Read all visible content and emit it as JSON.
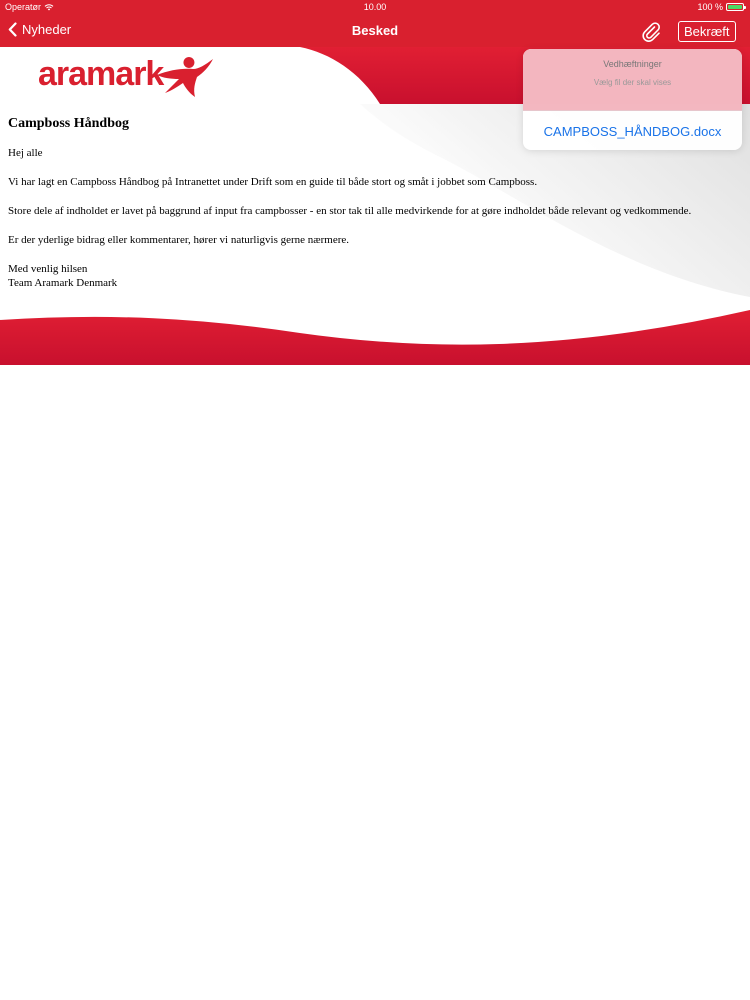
{
  "status_bar": {
    "carrier": "Operatør",
    "time": "10.00",
    "battery": "100 %",
    "battery_level": 1.0
  },
  "nav": {
    "back_label": "Nyheder",
    "title": "Besked",
    "confirm_label": "Bekræft"
  },
  "logo": {
    "text": "aramark"
  },
  "message": {
    "heading": "Campboss Håndbog",
    "greeting": "Hej alle",
    "paragraph_1": "Vi har lagt en Campboss Håndbog på Intranettet under Drift som en guide til både stort og småt i jobbet som Campboss.",
    "paragraph_2": "Store dele af indholdet er lavet på baggrund af input fra campbosser - en stor tak til alle medvirkende for at gøre indholdet både relevant og vedkommende.",
    "paragraph_3": "Er der yderlige bidrag eller kommentarer, hører vi naturligvis gerne nærmere.",
    "closing": "Med venlig hilsen",
    "signature": "Team Aramark Denmark"
  },
  "attachments_popover": {
    "title": "Vedhæftninger",
    "subtitle": "Vælg fil der skal vises",
    "files": [
      "CAMPBOSS_HÅNDBOG.docx"
    ]
  },
  "colors": {
    "brand_red": "#d9202f",
    "link_blue": "#1a73e8"
  },
  "icons": [
    "wifi-icon",
    "battery-icon",
    "chevron-left-icon",
    "paperclip-icon",
    "aramark-star-icon"
  ]
}
